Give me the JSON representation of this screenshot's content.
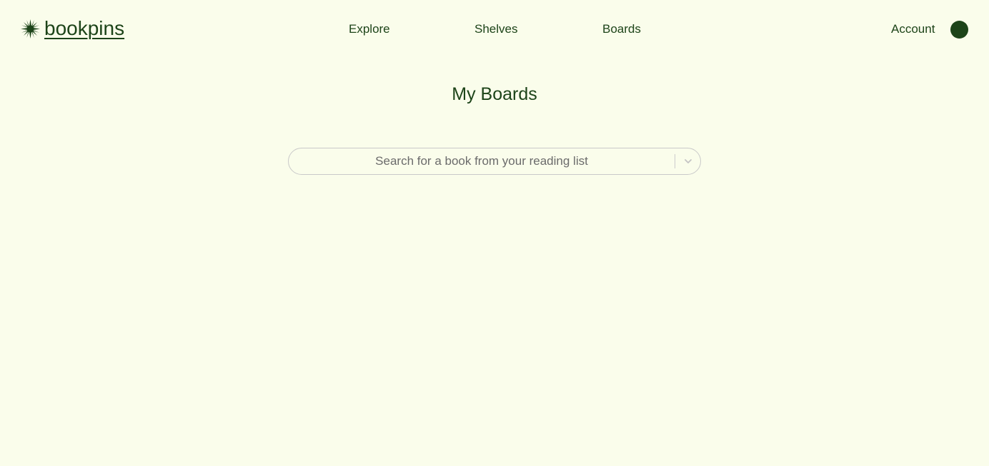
{
  "header": {
    "brand_name": "bookpins",
    "nav": {
      "explore": "Explore",
      "shelves": "Shelves",
      "boards": "Boards"
    },
    "account_label": "Account",
    "brand_color": "#1d4419"
  },
  "main": {
    "title": "My Boards",
    "book_search": {
      "placeholder": "Search for a book from your reading list",
      "value": ""
    }
  },
  "icons": {
    "brand": "starburst-icon",
    "dropdown": "chevron-down-icon"
  },
  "colors": {
    "background": "#fafdeb",
    "accent": "#1d4419",
    "border": "#c9c9c9",
    "placeholder": "#6b6b6b"
  }
}
